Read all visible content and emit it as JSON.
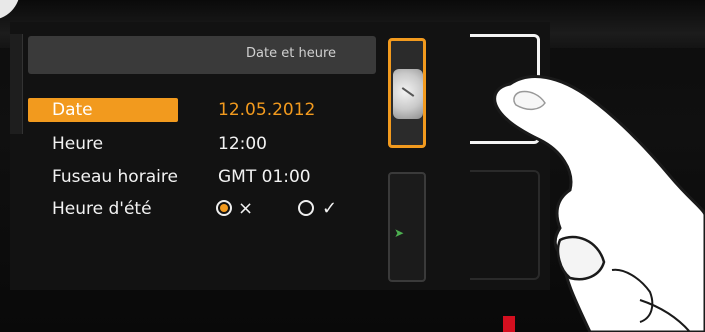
{
  "header": {
    "title": "Date et heure"
  },
  "rows": [
    {
      "label": "Date",
      "value_dd": "12",
      "value_mm": "05",
      "value_yyyy": "2012"
    },
    {
      "label": "Heure",
      "value": "12:00"
    },
    {
      "label": "Fuseau horaire",
      "value": "GMT 01:00"
    },
    {
      "label": "Heure d'été",
      "option_off": "×",
      "option_on": "✓"
    }
  ],
  "colors": {
    "accent": "#f29a1e",
    "background": "#121212"
  },
  "icons": {
    "side_button_1": "clock-icon",
    "radio_selected": "radio-selected-icon",
    "radio_unselected": "radio-unselected-icon"
  }
}
